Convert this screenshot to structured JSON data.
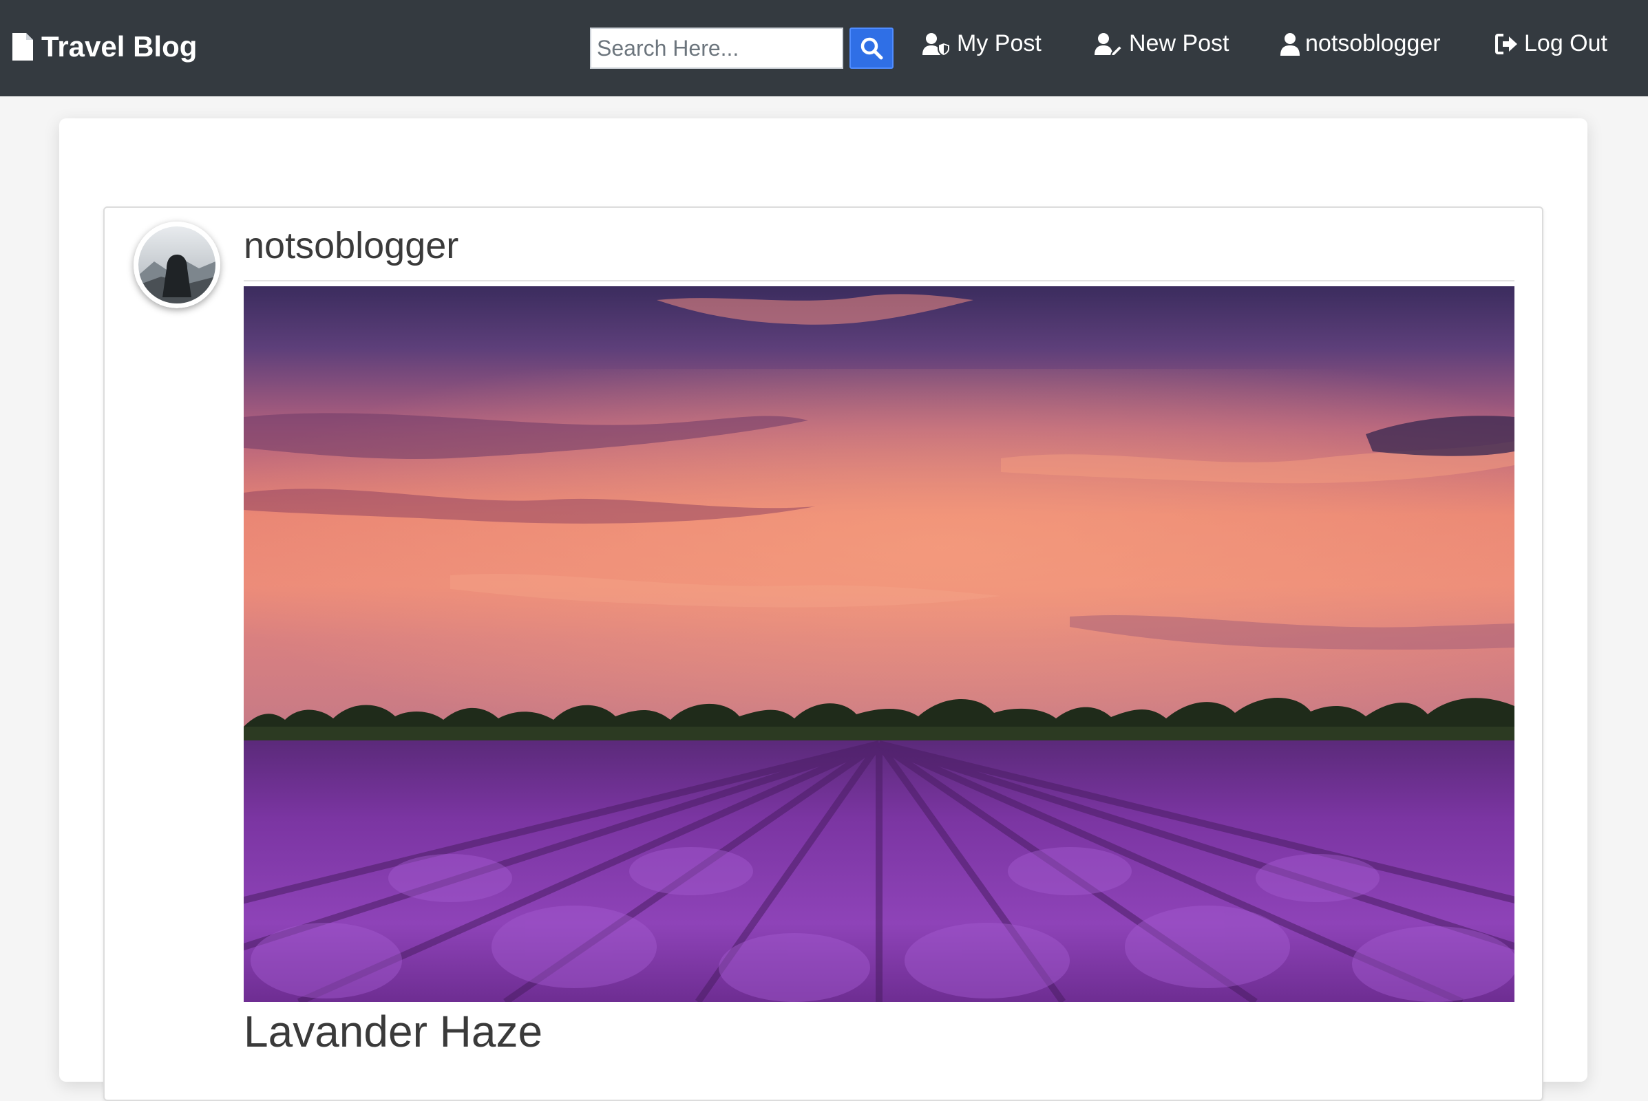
{
  "navbar": {
    "brand": "Travel Blog",
    "search_placeholder": "Search Here...",
    "search_value": "",
    "links": {
      "my_post": "My Post",
      "new_post": "New Post",
      "user": "notsoblogger",
      "logout": "Log Out"
    },
    "colors": {
      "background": "#343a40",
      "search_button": "#2f6fe6"
    }
  },
  "post": {
    "author": "notsoblogger",
    "title": "Lavander Haze",
    "image_icon": "lavender-field-sunset-photo",
    "avatar_icon": "hooded-figure-avatar"
  }
}
